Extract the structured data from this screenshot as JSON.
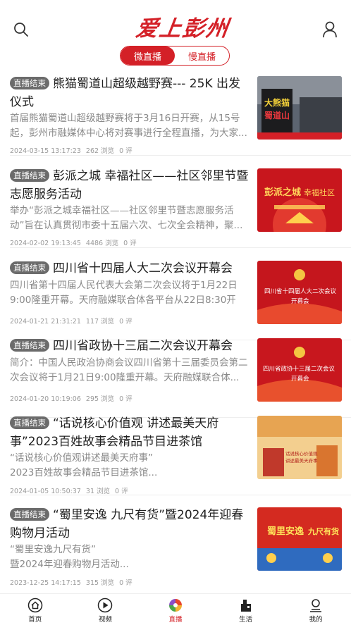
{
  "header": {
    "logo_text": "爱上彭州",
    "tabs": [
      {
        "label": "微直播",
        "active": true
      },
      {
        "label": "慢直播",
        "active": false
      }
    ]
  },
  "colors": {
    "accent": "#d42027",
    "badge_bg": "#6b6b6b",
    "muted_text": "#8a8a8a"
  },
  "items": [
    {
      "badge": "直播结束",
      "title": "熊猫蜀道山超级越野赛--- 25K 出发仪式",
      "desc": "首届熊猫蜀道山超级越野赛将于3月16日开赛，从15号起，彭州市融媒体中心将对赛事进行全程直播，为大家...",
      "date": "2024-03-15 13:17:23",
      "views": "262 浏览",
      "comments": "0 评"
    },
    {
      "badge": "直播结束",
      "title": "彭派之城 幸福社区——社区邻里节暨志愿服务活动",
      "desc": "举办“彭派之城幸福社区——社区邻里节暨志愿服务活动”旨在认真贯彻市委十五届六次、七次全会精神，聚...",
      "date": "2024-02-02 19:13:45",
      "views": "4486 浏览",
      "comments": "0 评"
    },
    {
      "badge": "直播结束",
      "title": "四川省十四届人大二次会议开幕会",
      "desc": "四川省第十四届人民代表大会第二次会议将于1月22日9:00隆重开幕。天府融媒联合体各平台从22日8:30开启...",
      "date": "2024-01-21 21:31:21",
      "views": "117 浏览",
      "comments": "0 评"
    },
    {
      "badge": "直播结束",
      "title": "四川省政协十三届二次会议开幕会",
      "desc": "简介：中国人民政治协商会议四川省第十三届委员会第二次会议将于1月21日9:00隆重开幕。天府融媒联合体...",
      "date": "2024-01-20 10:19:06",
      "views": "295 浏览",
      "comments": "0 评"
    },
    {
      "badge": "直播结束",
      "title": "“话说核心价值观 讲述最美天府事”2023百姓故事会精品节目进茶馆",
      "desc": "“话说核心价值观讲述最美天府事”\n2023百姓故事会精品节目进茶馆...",
      "date": "2024-01-05 10:50:37",
      "views": "31 浏览",
      "comments": "0 评"
    },
    {
      "badge": "直播结束",
      "title": "“蜀里安逸 九尺有货”暨2024年迎春购物月活动",
      "desc": "“蜀里安逸九尺有货”\n暨2024年迎春购物月活动...",
      "date": "2023-12-25 14:17:15",
      "views": "315 浏览",
      "comments": "0 评"
    }
  ],
  "thumbs": [
    {
      "text": "大熊猫 蜀道山"
    },
    {
      "text": "彭派之城 幸福社区"
    },
    {
      "text": "四川省十四届人大二次会议 开幕会"
    },
    {
      "text": "四川省政协十三届二次会议 开幕会"
    },
    {
      "text": "话说核心价值观 讲述最美天府事"
    },
    {
      "text": "蜀里安逸 九尺有货"
    }
  ],
  "tabbar": [
    {
      "label": "首页",
      "icon": "home-icon",
      "active": false
    },
    {
      "label": "视频",
      "icon": "play-icon",
      "active": false
    },
    {
      "label": "直播",
      "icon": "live-swirl-icon",
      "active": true
    },
    {
      "label": "生活",
      "icon": "life-icon",
      "active": false
    },
    {
      "label": "我的",
      "icon": "profile-icon",
      "active": false
    }
  ]
}
